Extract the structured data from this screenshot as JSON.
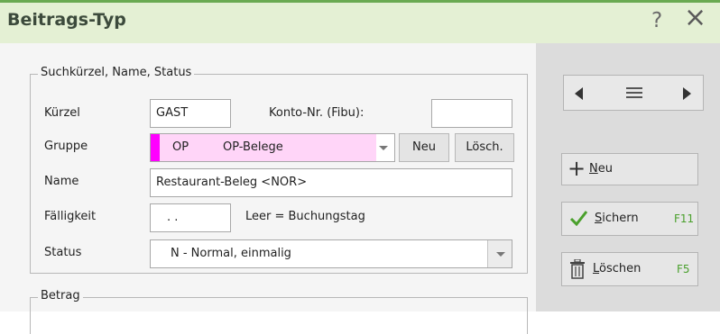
{
  "window": {
    "title": "Beitrags-Typ",
    "help_label": "?",
    "close_label": "×"
  },
  "group_main": {
    "legend": "Suchkürzel, Name, Status",
    "kuerzel": {
      "label": "Kürzel",
      "value": "GAST"
    },
    "konto": {
      "label": "Konto-Nr. (Fibu):",
      "value": ""
    },
    "gruppe": {
      "label": "Gruppe",
      "code": "OP",
      "name": "OP-Belege",
      "accent": "#ff00ff",
      "fill": "#ffd5f8",
      "new_label": "Neu",
      "delete_label": "Lösch."
    },
    "name": {
      "label": "Name",
      "value": "Restaurant-Beleg <NOR>"
    },
    "faelligkeit": {
      "label": "Fälligkeit",
      "value": ". .",
      "hint": "Leer = Buchungstag"
    },
    "status": {
      "label": "Status",
      "value": "N - Normal, einmalig"
    }
  },
  "group_betrag": {
    "legend": "Betrag"
  },
  "side": {
    "nav": {
      "prev_icon": "triangle-left-icon",
      "menu_icon": "hamburger-icon",
      "next_icon": "triangle-right-icon"
    },
    "new": {
      "icon": "plus-icon",
      "label_ul": "N",
      "label_rest": "eu"
    },
    "save": {
      "icon": "checkmark-icon",
      "label_ul": "S",
      "label_rest": "ichern",
      "key": "F11"
    },
    "delete": {
      "icon": "trash-icon",
      "label_ul": "L",
      "label_rest": "öschen",
      "key": "F5"
    }
  },
  "colors": {
    "title_bg": "#e4f0d4",
    "title_border": "#6aaa52",
    "panel_bg": "#dcdcdc",
    "key_green": "#4aa02c"
  }
}
